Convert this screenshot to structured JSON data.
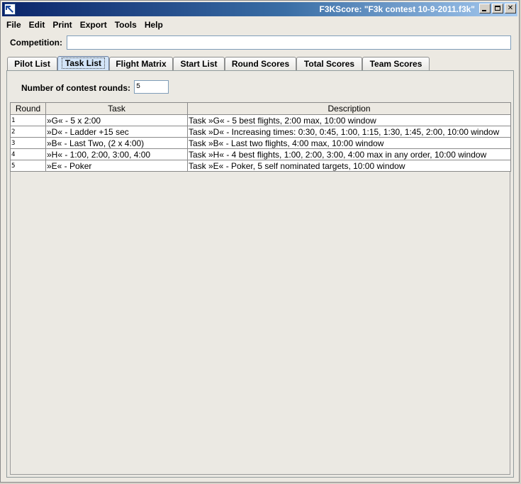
{
  "window": {
    "title": "F3KScore: \"F3k contest 10-9-2011.f3k\"",
    "controls": [
      "_",
      "□",
      "✕"
    ]
  },
  "menu": [
    "File",
    "Edit",
    "Print",
    "Export",
    "Tools",
    "Help"
  ],
  "competition": {
    "label": "Competition:",
    "value": ""
  },
  "tabs": [
    {
      "label": "Pilot List",
      "active": false
    },
    {
      "label": "Task List",
      "active": true
    },
    {
      "label": "Flight Matrix",
      "active": false
    },
    {
      "label": "Start List",
      "active": false
    },
    {
      "label": "Round Scores",
      "active": false
    },
    {
      "label": "Total Scores",
      "active": false
    },
    {
      "label": "Team Scores",
      "active": false
    }
  ],
  "rounds": {
    "label": "Number of contest rounds:",
    "value": "5"
  },
  "table": {
    "headers": [
      "Round",
      "Task",
      "Description"
    ],
    "rows": [
      {
        "round": "1",
        "task": "»G« - 5 x 2:00",
        "description": "Task »G« - 5 best flights, 2:00 max, 10:00 window"
      },
      {
        "round": "2",
        "task": "»D« - Ladder +15 sec",
        "description": "Task »D« - Increasing times: 0:30, 0:45, 1:00, 1:15, 1:30, 1:45, 2:00, 10:00 window"
      },
      {
        "round": "3",
        "task": "»B« - Last Two, (2 x 4:00)",
        "description": "Task »B« - Last two flights, 4:00 max, 10:00 window"
      },
      {
        "round": "4",
        "task": "»H« - 1:00, 2:00, 3:00, 4:00",
        "description": "Task »H« - 4 best flights, 1:00, 2:00, 3:00, 4:00 max in any order, 10:00 window"
      },
      {
        "round": "5",
        "task": "»E« - Poker",
        "description": "Task »E« - Poker, 5 self nominated targets, 10:00 window"
      }
    ]
  }
}
